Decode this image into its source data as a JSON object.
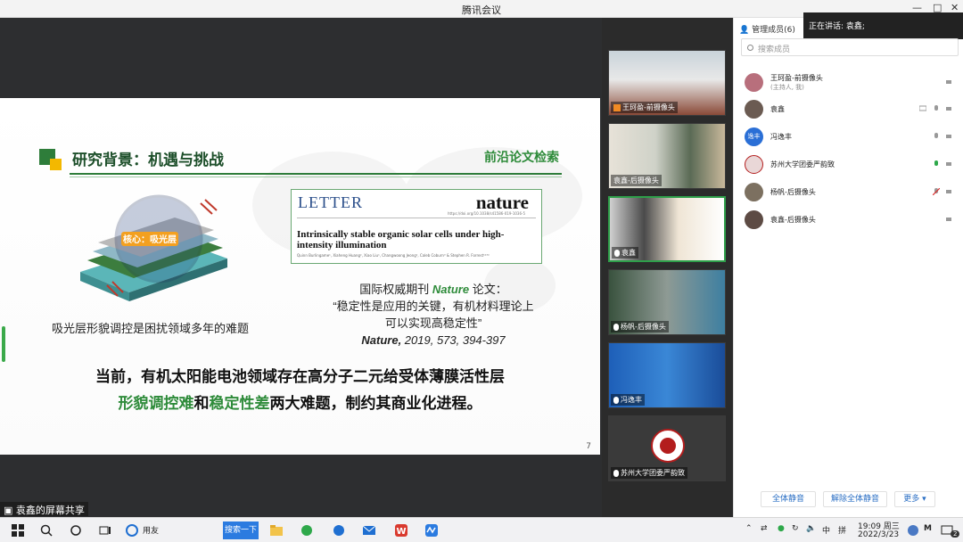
{
  "window": {
    "title": "腾讯会议"
  },
  "slide": {
    "title": "研究背景：机遇与挑战",
    "tag": "前沿论文检索",
    "core_label": "核心：吸光层",
    "device_caption": "吸光层形貌调控是困扰领域多年的难题",
    "letter": {
      "type": "LETTER",
      "journal": "nature",
      "doi": "https://doi.org/10.1038/s41586-019-1036-5",
      "paper_title": "Intrinsically stable organic solar cells under high-intensity illumination",
      "authors": "Quinn Burlingame¹, Xiaheng Huang², Xiao Liu¹, Changwoong Jeong², Caleb Coburn³ & Stephen R. Forrest¹²³⁴"
    },
    "quote_line1_pre": "国际权威期刊 ",
    "quote_line1_journal": "Nature",
    "quote_line1_post": " 论文：",
    "quote_line2": "“稳定性是应用的关键，有机材料理论上",
    "quote_line3": "可以实现高稳定性”",
    "quote_cite_journal": "Nature,",
    "quote_cite_year": " 2019, ",
    "quote_cite_vol": "573",
    "quote_cite_pages": ", 394-397",
    "bottom_line1": "当前，有机太阳能电池领域存在高分子二元给受体薄膜活性层",
    "bottom_line2_a": "形貌调控难",
    "bottom_line2_b": "和",
    "bottom_line2_c": "稳定性差",
    "bottom_line2_d": "两大难题，制约其商业化进程。",
    "page_number": "7"
  },
  "share_label": "袁鑫的屏幕共享",
  "videos": [
    {
      "label": "王珂盈-前摄像头"
    },
    {
      "label": "袁鑫-后摄像头"
    },
    {
      "label": "袁鑫"
    },
    {
      "label": "杨帆-后摄像头"
    },
    {
      "label": "冯逸丰"
    },
    {
      "label": "苏州大学团委严韵致"
    }
  ],
  "panel": {
    "header": "管理成员(6)",
    "speaking": "正在讲话: 袁鑫;",
    "search_placeholder": "搜索成员",
    "members": [
      {
        "name": "王珂盈-前摄像头",
        "sub": "(主持人, 我)",
        "avatar": ""
      },
      {
        "name": "袁鑫",
        "sub": "",
        "avatar": ""
      },
      {
        "name": "冯逸丰",
        "sub": "",
        "avatar": "逸丰"
      },
      {
        "name": "苏州大学团委严韵致",
        "sub": "",
        "avatar": ""
      },
      {
        "name": "杨帆-后摄像头",
        "sub": "",
        "avatar": ""
      },
      {
        "name": "袁鑫-后摄像头",
        "sub": "",
        "avatar": ""
      }
    ],
    "mute_all": "全体静音",
    "unmute_all": "解除全体静音",
    "more": "更多 ▾"
  },
  "taskbar": {
    "search_btn": "搜索一下",
    "app_label": "用友",
    "ime": "中",
    "ime2": "拼",
    "time": "19:09 周三",
    "date": "2022/3/23",
    "notif": "2",
    "colors": {
      "edge": "#1f6fd1",
      "wps": "#d93a2e",
      "meeting": "#2b7be0"
    }
  }
}
